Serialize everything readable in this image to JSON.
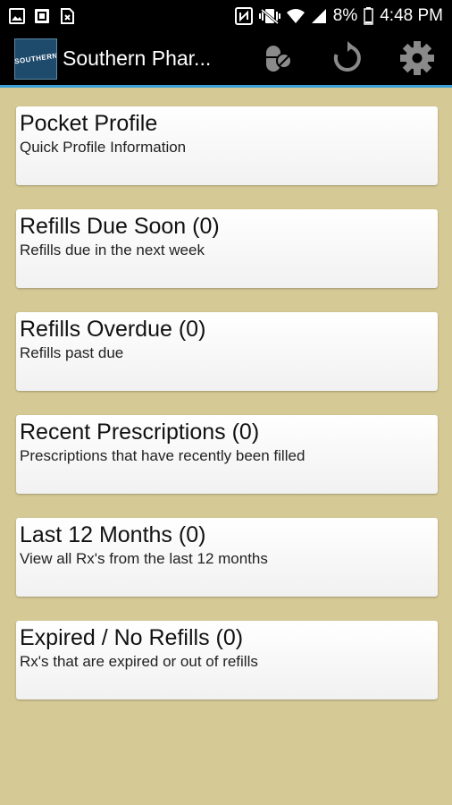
{
  "status_bar": {
    "left_icons": [
      "image-icon",
      "screenshot-icon",
      "no-sim-icon"
    ],
    "right_icons": [
      "nfc-icon",
      "vibrate-icon",
      "wifi-icon",
      "signal-icon"
    ],
    "battery_percent": "8%",
    "time": "4:48 PM"
  },
  "app_bar": {
    "logo_text": "SOUTHERN",
    "title": "Southern Phar...",
    "actions": [
      "pill-icon",
      "refresh-icon",
      "settings-icon"
    ]
  },
  "menu": [
    {
      "title": "Pocket Profile",
      "subtitle": "Quick Profile Information"
    },
    {
      "title": "Refills Due Soon (0)",
      "subtitle": "Refills due in the next week"
    },
    {
      "title": "Refills Overdue (0)",
      "subtitle": "Refills past due"
    },
    {
      "title": "Recent Prescriptions (0)",
      "subtitle": "Prescriptions that have recently been filled"
    },
    {
      "title": "Last 12 Months (0)",
      "subtitle": "View all Rx's from the last 12 months"
    },
    {
      "title": "Expired / No Refills (0)",
      "subtitle": "Rx's that are expired or out of refills"
    }
  ],
  "colors": {
    "background": "#d5c995",
    "bar": "#000000",
    "accent_line": "#3d9fd6",
    "card": "#fbfbfb"
  }
}
